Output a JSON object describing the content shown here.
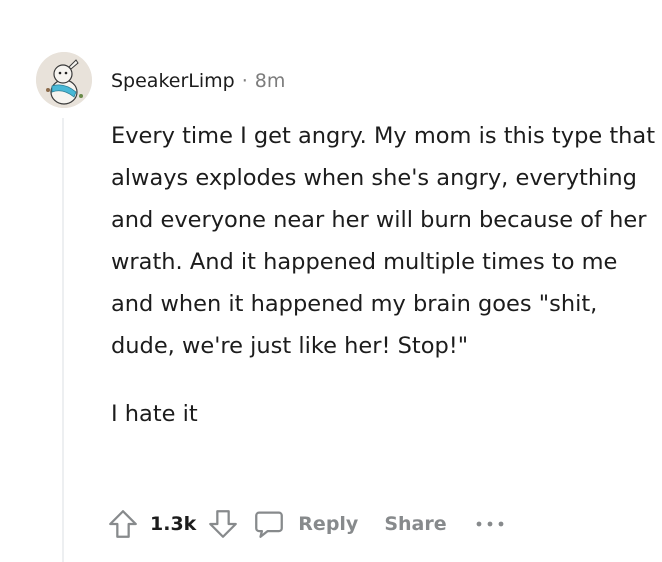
{
  "comment": {
    "username": "SpeakerLimp",
    "separator": "·",
    "time": "8m",
    "body": {
      "paragraph_1": "Every time I get angry. My mom is this type that always explodes when she's angry, everything and everyone near her will burn because of her wrath. And it happened multiple times to me and when it happened my brain goes \"shit, dude, we're just like her! Stop!\"",
      "paragraph_2": "I hate it"
    },
    "actions": {
      "vote_count": "1.3k",
      "reply_label": "Reply",
      "share_label": "Share"
    },
    "icons": {
      "upvote": "arrow-up-outline-icon",
      "downvote": "arrow-down-outline-icon",
      "reply": "speech-bubble-icon",
      "more": "more-horizontal-icon",
      "avatar": "snoo-avatar"
    },
    "colors": {
      "text": "#1c1c1c",
      "meta": "#7c7c7c",
      "action": "#878a8c",
      "thread_line": "#edeff1"
    }
  }
}
